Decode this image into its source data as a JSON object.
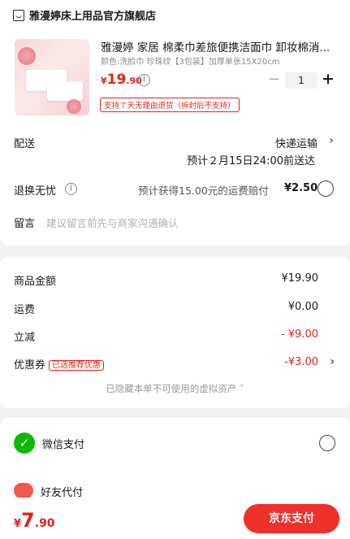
{
  "shop": {
    "name": "雅漫婷床上用品官方旗舰店",
    "icon": "shop-icon"
  },
  "product": {
    "title": "雅漫婷 家居 棉柔巾差旅便携洁面巾 卸妆棉消...",
    "spec": "颜色:洗脸巾 珍珠纹【3包装】加厚单张15X20cm",
    "price_symbol": "¥",
    "price_int": "19",
    "price_dec": ".90",
    "quantity": "1",
    "minus": "−",
    "plus": "+",
    "policy": "支持７天无理由退货（拆封后不支持）"
  },
  "delivery": {
    "label": "配送",
    "method": "快递运输",
    "estimate": "预计２月15日24:00前送达"
  },
  "returns": {
    "label": "退换无忧",
    "desc": "预计获得15.00元的运费赔付",
    "price": "¥2.50"
  },
  "message": {
    "label": "留言",
    "placeholder": "建议留言前先与商家沟通确认"
  },
  "summary": {
    "goods_label": "商品金额",
    "goods_value": "¥19.90",
    "shipping_label": "运费",
    "shipping_value": "¥0.00",
    "discount_label": "立减",
    "discount_value": "- ¥9.00",
    "coupon_label": "优惠券",
    "coupon_tag": "已选推荐优惠",
    "coupon_value": "-¥3.00",
    "hidden_note": "已隐藏本单不可使用的虚拟资产 ˅"
  },
  "payment": {
    "wechat_label": "微信支付",
    "friend_label": "好友代付"
  },
  "bottom": {
    "total_symbol": "¥",
    "total_int": "7",
    "total_dec": ".90",
    "pay_button": "京东支付"
  },
  "colors": {
    "accent": "#e2231a",
    "wechat": "#09bb07"
  }
}
